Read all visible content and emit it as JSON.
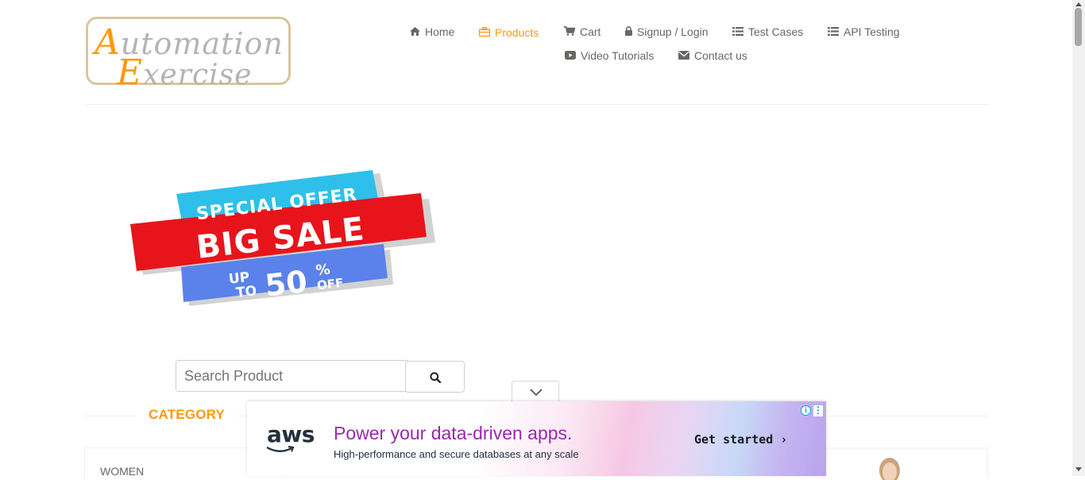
{
  "logo": {
    "line1_first": "A",
    "line1_rest": "utomation",
    "line2_first": "E",
    "line2_rest": "xercise"
  },
  "nav": {
    "items": [
      {
        "label": "Home",
        "icon": "home-icon"
      },
      {
        "label": "Products",
        "icon": "briefcase-icon",
        "active": true
      },
      {
        "label": "Cart",
        "icon": "cart-icon"
      },
      {
        "label": "Signup / Login",
        "icon": "lock-icon"
      },
      {
        "label": "Test Cases",
        "icon": "list-icon"
      },
      {
        "label": "API Testing",
        "icon": "list-icon"
      },
      {
        "label": "Video Tutorials",
        "icon": "youtube-play-icon"
      },
      {
        "label": "Contact us",
        "icon": "envelope-icon"
      }
    ]
  },
  "banner": {
    "line1": "SPECIAL OFFER",
    "line2": "BIG SALE",
    "up": "UP",
    "to": "TO",
    "pct": "50",
    "pct_sign": "%",
    "off": "OFF"
  },
  "search": {
    "placeholder": "Search Product",
    "icon": "search-icon"
  },
  "category": {
    "title": "CATEGORY",
    "items": [
      "WOMEN"
    ]
  },
  "ad": {
    "brand": "aws",
    "headline": "Power your data-driven apps.",
    "subtext": "High-performance and secure databases at any scale",
    "cta": "Get started ›",
    "info_glyph": "i",
    "menu_glyph": "⋮"
  },
  "colors": {
    "accent": "#fe980f",
    "text": "#696763",
    "ad_headline": "#9b27b0"
  }
}
